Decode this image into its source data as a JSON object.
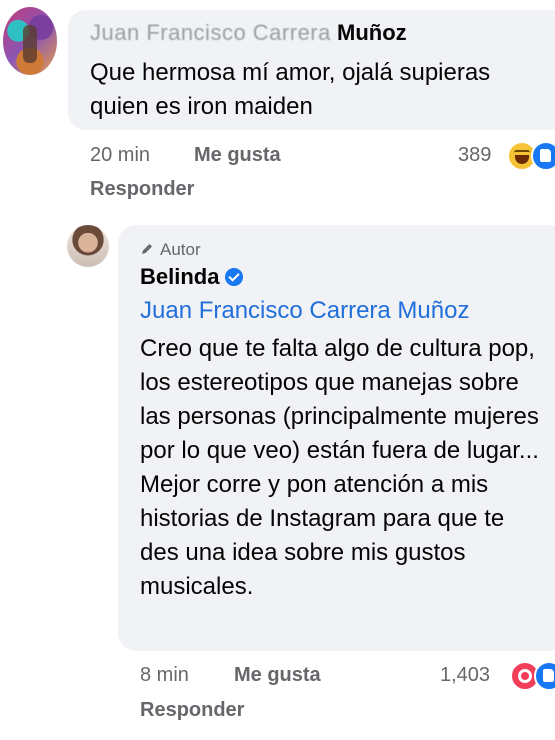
{
  "comments": [
    {
      "author_obscured": "Juan Francisco Carrera",
      "author_visible": "Muñoz",
      "text": "Que hermosa mí amor, ojalá supieras quien es iron maiden",
      "time": "20 min",
      "like_label": "Me gusta",
      "reply_label": "Responder",
      "reaction_count": "389",
      "reactions": [
        "haha-icon",
        "like-icon"
      ]
    },
    {
      "badge": "Autor",
      "author": "Belinda",
      "mention": "Juan Francisco Carrera Muñoz",
      "text": "Creo que te falta algo de cultura pop, los estereotipos que manejas sobre las personas (principalmente mujeres por lo que veo) están fuera de lugar... Mejor corre y pon atención a mis historias de Instagram para que te des una idea sobre mis gustos musicales.",
      "time": "8 min",
      "like_label": "Me gusta",
      "reply_label": "Responder",
      "reaction_count": "1,403",
      "reactions": [
        "love-icon",
        "like-icon"
      ]
    }
  ],
  "colors": {
    "bubble": "#f0f2f5",
    "mention": "#216fdb",
    "meta": "#65676b",
    "verified": "#1877f2"
  }
}
